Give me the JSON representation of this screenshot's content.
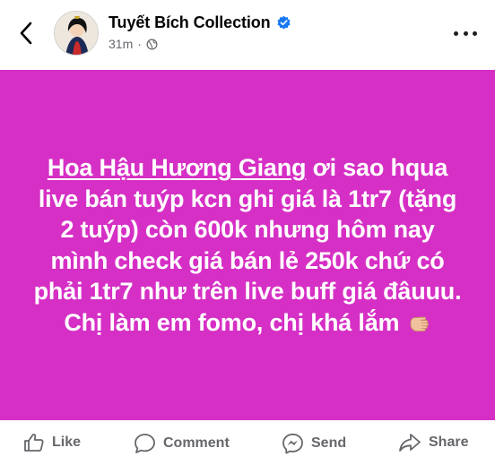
{
  "header": {
    "page_name": "Tuyết Bích Collection",
    "time": "31m",
    "separator": "·",
    "privacy_icon": "globe-icon",
    "verified_icon": "verified-badge-icon",
    "back_icon": "chevron-left-icon",
    "more_icon": "more-horizontal-icon"
  },
  "post": {
    "background_color": "#d62fc5",
    "mention": "Hoa Hậu Hương Giang",
    "body": " ơi sao hqua live bán tuýp kcn ghi giá là 1tr7 (tặng 2 tuýp) còn 600k nhưng hôm nay mình check giá bán lẻ 250k chứ có phải 1tr7 như trên live buff giá đâuuu. Chị làm em fomo, chị khá lắm ",
    "emoji_icon": "pointing-fist-emoji-icon"
  },
  "actions": [
    {
      "label": "Like",
      "icon": "thumbs-up-icon"
    },
    {
      "label": "Comment",
      "icon": "comment-bubble-icon"
    },
    {
      "label": "Send",
      "icon": "messenger-icon"
    },
    {
      "label": "Share",
      "icon": "share-arrow-icon"
    }
  ]
}
